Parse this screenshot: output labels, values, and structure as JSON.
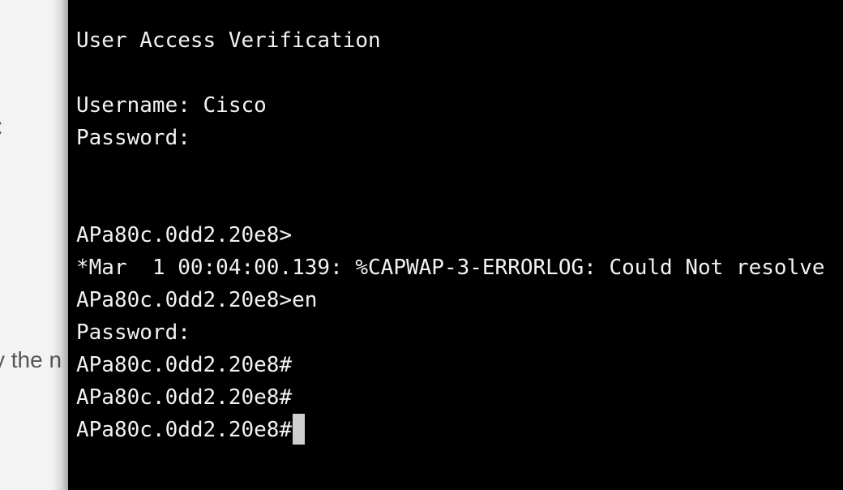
{
  "background_doc": {
    "colon_fragment": ":",
    "text_fragment": "y the n"
  },
  "terminal": {
    "lines": [
      "User Access Verification",
      "",
      "Username: Cisco",
      "Password:",
      "",
      "",
      "APa80c.0dd2.20e8>",
      "*Mar  1 00:04:00.139: %CAPWAP-3-ERRORLOG: Could Not resolve",
      "APa80c.0dd2.20e8>en",
      "Password:",
      "APa80c.0dd2.20e8#",
      "APa80c.0dd2.20e8#",
      "APa80c.0dd2.20e8#"
    ],
    "background_color": "#000000",
    "text_color": "#f2f2f2",
    "cursor_color": "#cfcfcf"
  }
}
